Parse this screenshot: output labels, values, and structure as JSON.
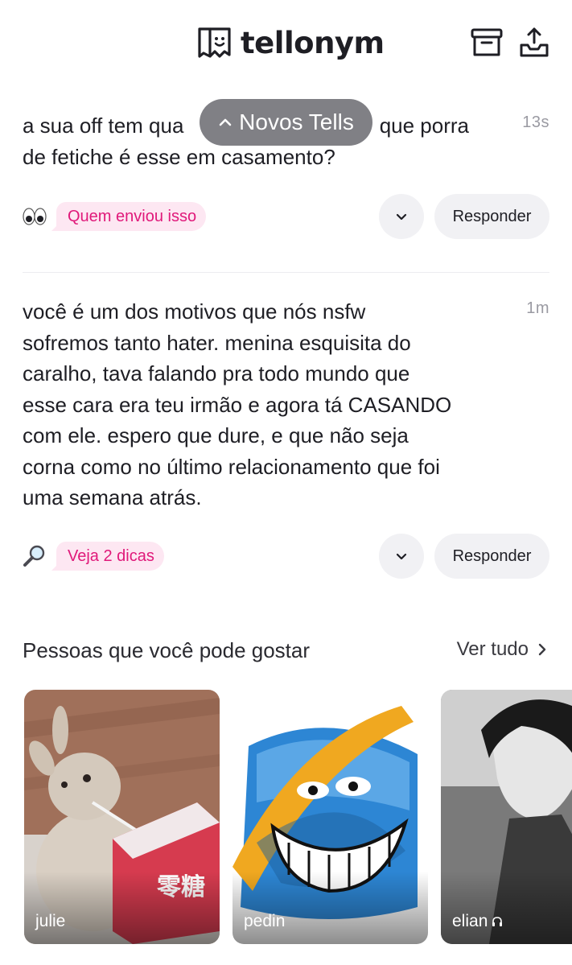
{
  "header": {
    "logo_text": "tellonym",
    "archive_icon": "archive-box-icon",
    "share_icon": "share-upload-icon"
  },
  "new_tells_pill": {
    "label": "Novos Tells",
    "icon": "chevron-up-icon"
  },
  "tells": [
    {
      "text": "a sua off tem quase 30 anos, que porra de fetiche é esse em casamento?",
      "visible_lines": [
        "a sua off tem qua",
        "que porra",
        "de fetiche é esse em casamento?"
      ],
      "time": "13s",
      "hint_emoji": "eyes-emoji-icon",
      "hint_label": "Quem enviou isso",
      "reply_label": "Responder"
    },
    {
      "text": "você é um dos motivos que nós nsfw sofremos tanto hater. menina esquisita do caralho, tava falando pra todo mundo que esse cara era teu irmão e agora tá CASANDO com ele. espero que dure, e que não seja corna como no último relacionamento que foi uma semana atrás.",
      "visible_lines": [
        "você é um dos motivos que nós nsfw",
        "sofremos tanto hater. menina esquisita do",
        "caralho, tava falando pra todo mundo que",
        "esse cara era teu irmão e agora tá CASANDO",
        "com ele. espero que dure, e que não seja",
        "corna como no último relacionamento que foi",
        "uma semana atrás."
      ],
      "time": "1m",
      "hint_emoji": "magnifier-emoji-icon",
      "hint_label": "Veja 2 dicas",
      "reply_label": "Responder"
    }
  ],
  "suggestions": {
    "title": "Pessoas que você pode gostar",
    "see_all": "Ver tudo",
    "people": [
      {
        "name": "julie"
      },
      {
        "name": "pedin"
      },
      {
        "name": "elian"
      }
    ]
  },
  "colors": {
    "accent_pink": "#e0197a",
    "badge_bg": "#fde7f2",
    "button_bg": "#f1f1f4",
    "pill_bg": "#6e6e74"
  }
}
